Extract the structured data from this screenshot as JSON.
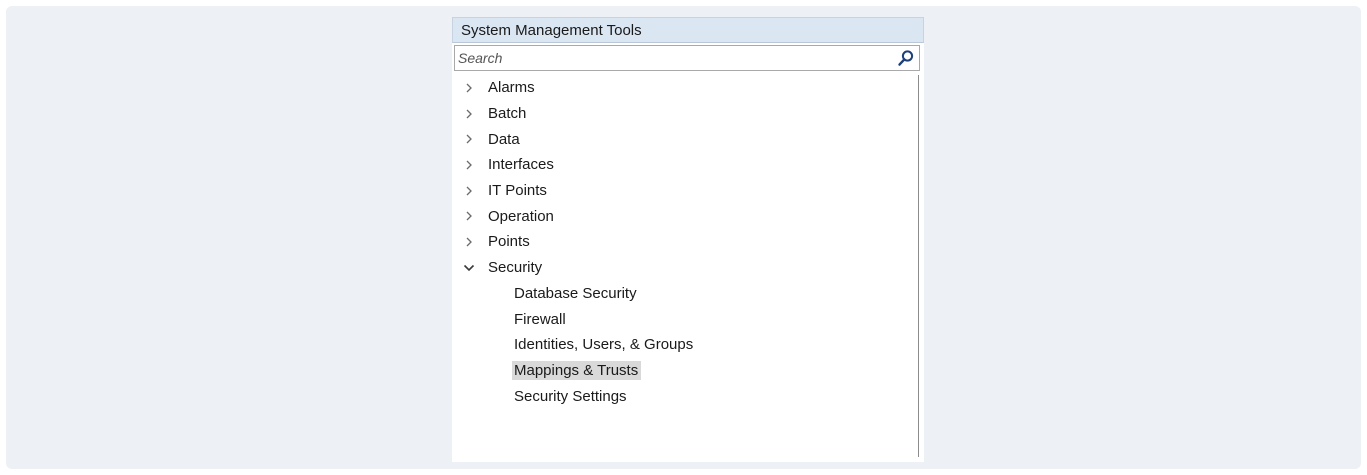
{
  "panel": {
    "title": "System Management Tools"
  },
  "search": {
    "placeholder": "Search",
    "value": ""
  },
  "tree": {
    "groups": [
      {
        "label": "Alarms",
        "expanded": false
      },
      {
        "label": "Batch",
        "expanded": false
      },
      {
        "label": "Data",
        "expanded": false
      },
      {
        "label": "Interfaces",
        "expanded": false
      },
      {
        "label": "IT Points",
        "expanded": false
      },
      {
        "label": "Operation",
        "expanded": false
      },
      {
        "label": "Points",
        "expanded": false
      },
      {
        "label": "Security",
        "expanded": true,
        "children": [
          {
            "label": "Database Security",
            "selected": false
          },
          {
            "label": "Firewall",
            "selected": false
          },
          {
            "label": "Identities, Users, & Groups",
            "selected": false
          },
          {
            "label": "Mappings & Trusts",
            "selected": true
          },
          {
            "label": "Security Settings",
            "selected": false
          }
        ]
      }
    ]
  },
  "icons": {
    "collapsed": "chevron-right-icon",
    "expanded": "chevron-down-icon",
    "search": "search-icon"
  },
  "colors": {
    "header_bg": "#dbe6f3",
    "selected_bg": "#d9d9d9",
    "page_bg": "#edf0f5"
  }
}
